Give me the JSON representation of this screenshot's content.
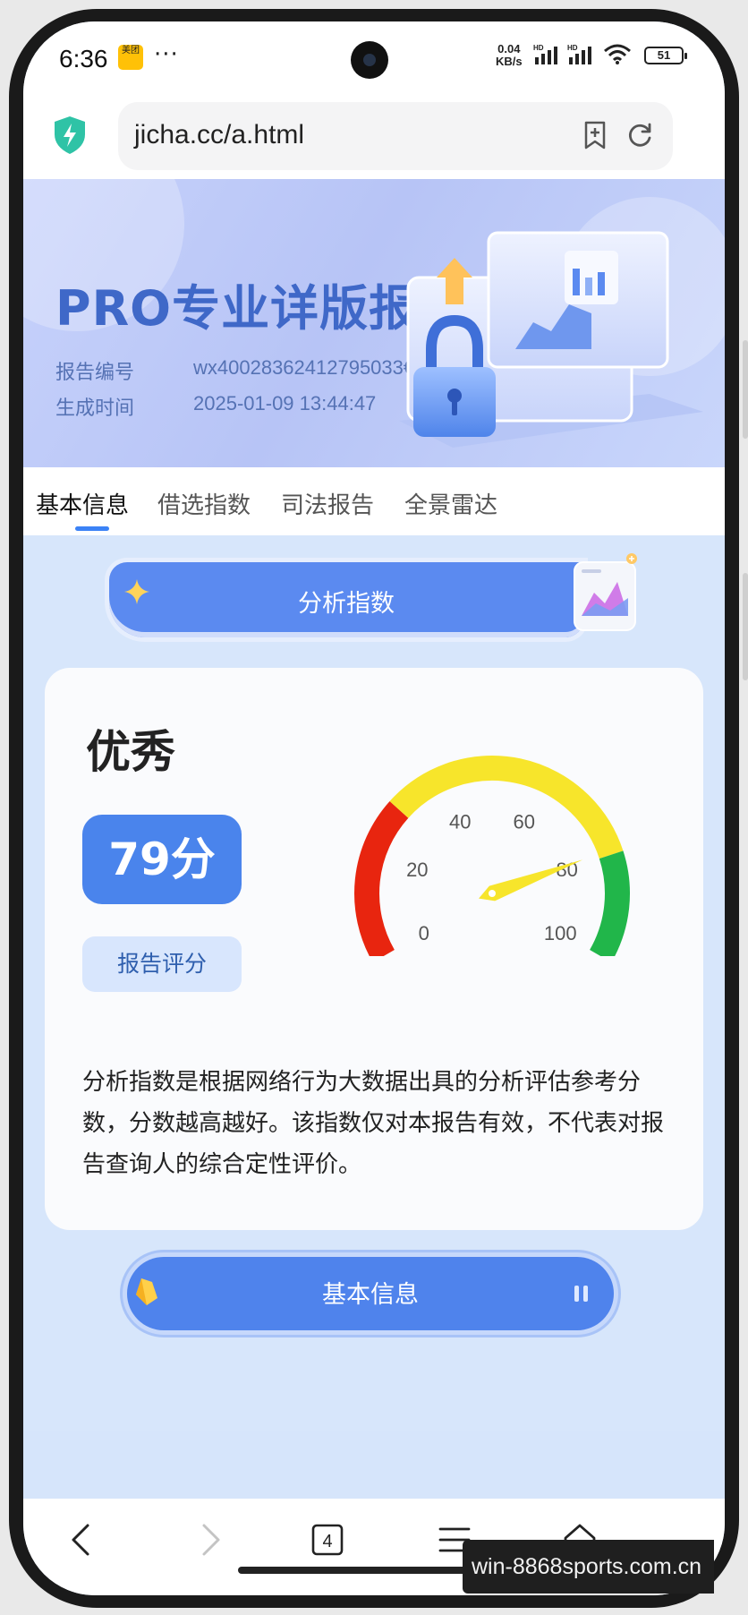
{
  "status_bar": {
    "time": "6:36",
    "app_badge": "美团",
    "dots": "···",
    "net_speed_value": "0.04",
    "net_speed_unit": "KB/s",
    "signal_label": "HD",
    "battery": "51"
  },
  "browser": {
    "url": "jicha.cc/a.html",
    "security_icon": "shield-bolt-icon",
    "actions": [
      "bookmark-add-icon",
      "reload-icon"
    ],
    "tab_count": "4",
    "nav_icons": [
      "back-icon",
      "forward-icon",
      "tabs-icon",
      "menu-icon",
      "home-icon"
    ]
  },
  "hero": {
    "title": "PRO专业详版报告",
    "report_no_label": "报告编号",
    "report_no": "wx40028362412795033€",
    "time_label": "生成时间",
    "time": "2025-01-09 13:44:47"
  },
  "tabs": [
    {
      "label": "基本信息",
      "active": true
    },
    {
      "label": "借选指数",
      "active": false
    },
    {
      "label": "司法报告",
      "active": false
    },
    {
      "label": "全景雷达",
      "active": false
    }
  ],
  "analysis": {
    "section_title": "分析指数",
    "grade": "优秀",
    "score_text": "79分",
    "score_value": 79,
    "score_label": "报告评分",
    "gauge": {
      "min": 0,
      "max": 100,
      "ticks": [
        "0",
        "20",
        "40",
        "60",
        "80",
        "100"
      ],
      "colors": {
        "low": "#e8250f",
        "mid": "#f7e52b",
        "high": "#21b64a",
        "needle": "#f7e52b"
      }
    },
    "description": "分析指数是根据网络行为大数据出具的分析评估参考分数，分数越高越好。该指数仅对本报告有效，不代表对报告查询人的综合定性评价。"
  },
  "next_section": {
    "title": "基本信息"
  },
  "watermark": "win-8868sports.com.cn",
  "colors": {
    "accent": "#4a84ec",
    "hero_title": "#3f68c8",
    "page_bg": "#d7e6fb"
  }
}
